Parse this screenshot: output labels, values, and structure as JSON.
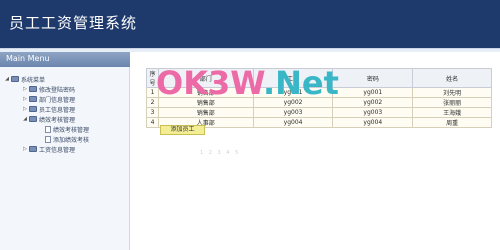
{
  "header": {
    "title": "员工工资管理系统"
  },
  "sidebar": {
    "menu_title": "Main Menu",
    "items": [
      {
        "label": "系统菜单",
        "expanded": true,
        "icon": "folder-icon",
        "depth": 0
      },
      {
        "label": "修改登陆密码",
        "icon": "folder-icon",
        "depth": 1
      },
      {
        "label": "部门信息管理",
        "icon": "folder-icon",
        "depth": 1
      },
      {
        "label": "员工信息管理",
        "icon": "folder-icon",
        "depth": 1
      },
      {
        "label": "绩效考核管理",
        "expanded": true,
        "icon": "folder-icon",
        "depth": 1
      },
      {
        "label": "绩效考核管理",
        "icon": "page-icon",
        "depth": 2
      },
      {
        "label": "添加绩效考核",
        "icon": "page-icon",
        "depth": 2
      },
      {
        "label": "工资信息管理",
        "icon": "folder-icon",
        "depth": 1
      }
    ]
  },
  "table": {
    "headers": [
      "序号",
      "部门",
      "工号",
      "密码",
      "姓名"
    ],
    "rows": [
      [
        "1",
        "销售部",
        "yg001",
        "yg001",
        "刘先明"
      ],
      [
        "2",
        "销售部",
        "yg002",
        "yg002",
        "张丽丽"
      ],
      [
        "3",
        "销售部",
        "yg003",
        "yg003",
        "王海娥"
      ],
      [
        "4",
        "人事部",
        "yg004",
        "yg004",
        "周重"
      ]
    ]
  },
  "actions": {
    "add_employee": "添加员工"
  },
  "pager": {
    "text": "1 2 3 4 5"
  },
  "watermark": {
    "part1": "OK3W",
    "part2": ".Net"
  },
  "colors": {
    "header_bg": "#1e3a6d",
    "menu_head": "#6a85ad",
    "button_bg": "#f3ee96",
    "watermark_pink": "#ec6aa6",
    "watermark_teal": "#39b7c7"
  }
}
